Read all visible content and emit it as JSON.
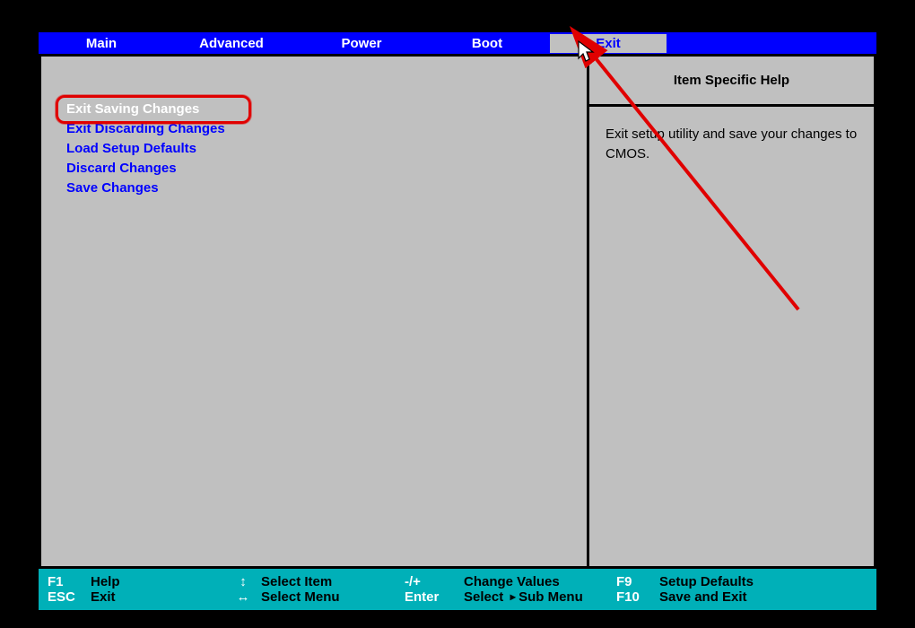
{
  "tabs": {
    "main": "Main",
    "advanced": "Advanced",
    "power": "Power",
    "boot": "Boot",
    "exit": "Exit"
  },
  "menu": {
    "exit_save": "Exit Saving Changes",
    "exit_discard": "Exit Discarding Changes",
    "load_defaults": "Load Setup Defaults",
    "discard": "Discard Changes",
    "save": "Save Changes"
  },
  "help": {
    "title": "Item Specific Help",
    "text": "Exit setup utility and save your changes to CMOS."
  },
  "footer": {
    "f1": "F1",
    "help": "Help",
    "esc": "ESC",
    "exit": "Exit",
    "updown": "↕",
    "select_item": "Select Item",
    "leftright": "↔",
    "select_menu": "Select Menu",
    "plusminus": "-/+",
    "change_values": "Change Values",
    "enter": "Enter",
    "select_sub": "Select",
    "submenu": "Sub Menu",
    "f9": "F9",
    "setup_defaults": "Setup Defaults",
    "f10": "F10",
    "save_exit": "Save and Exit"
  }
}
